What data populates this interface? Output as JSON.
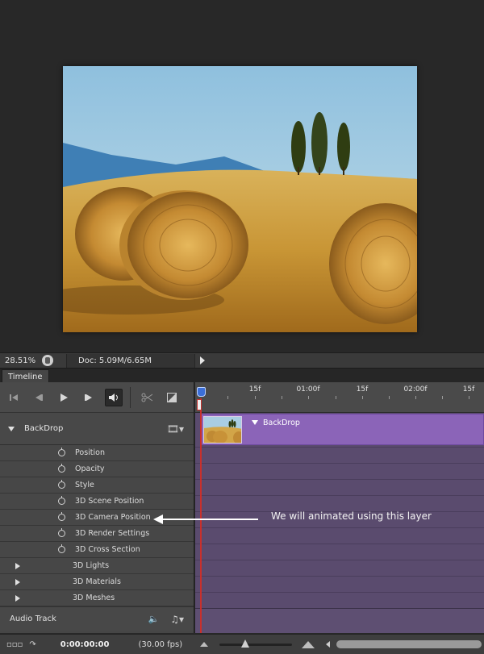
{
  "status": {
    "zoom": "28.51%",
    "doc_info": "Doc: 5.09M/6.65M"
  },
  "panel": {
    "tab_label": "Timeline"
  },
  "ruler": {
    "ticks": [
      "15f",
      "01:00f",
      "15f",
      "02:00f",
      "15f"
    ]
  },
  "layer": {
    "name": "BackDrop",
    "clip_label": "BackDrop",
    "properties": [
      "Position",
      "Opacity",
      "Style",
      "3D Scene Position",
      "3D Camera Position",
      "3D Render Settings",
      "3D Cross Section"
    ],
    "groups": [
      "3D Lights",
      "3D Materials",
      "3D Meshes"
    ]
  },
  "audio": {
    "label": "Audio Track"
  },
  "annotation": {
    "text": "We will animated using this layer"
  },
  "bottom": {
    "timecode": "0:00:00:00",
    "fps": "(30.00 fps)",
    "zoom_level": 0.35
  },
  "colors": {
    "clip": "#8b64b8",
    "track_bg": "#5a4b6e",
    "playhead": "#c9302c",
    "playhead_handle": "#3c6fd8"
  },
  "icons": {
    "stopwatch": "stopwatch-icon",
    "film": "film-strip-icon",
    "speaker": "speaker-icon",
    "music": "music-note-icon"
  }
}
